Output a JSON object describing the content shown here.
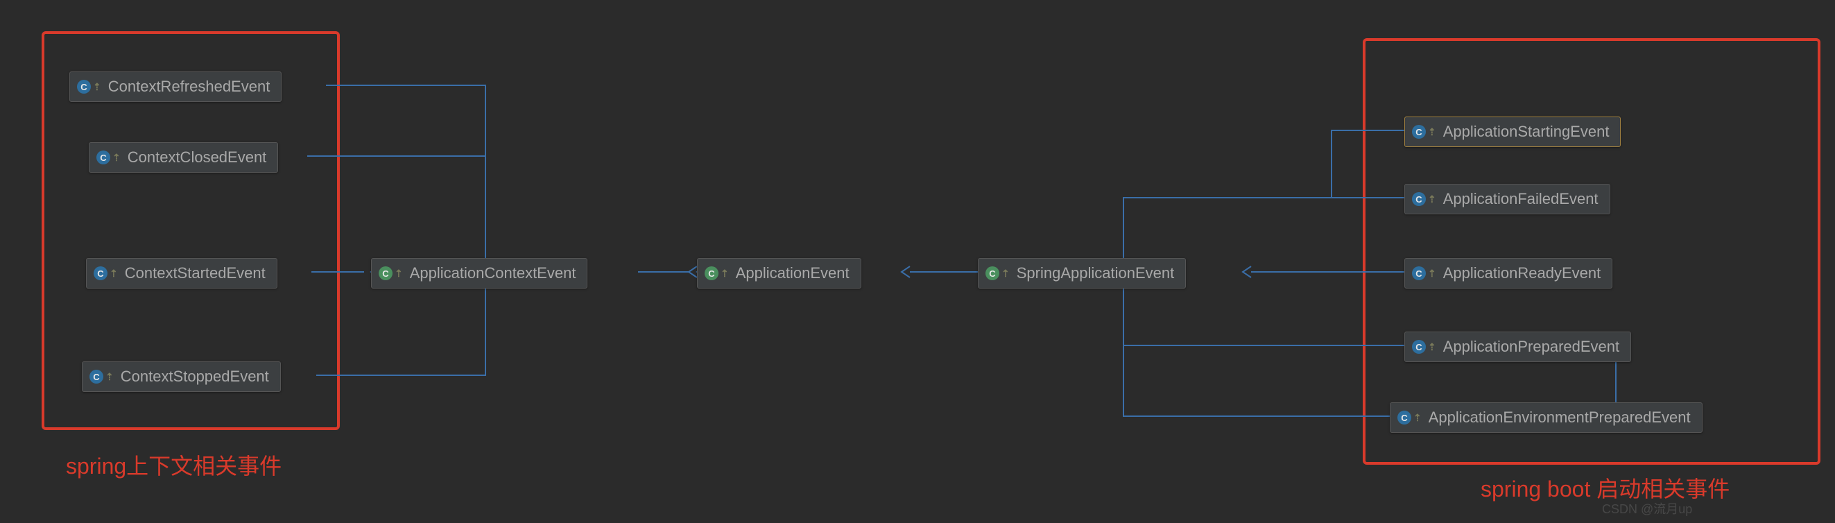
{
  "nodes": {
    "context_refreshed": {
      "label": "ContextRefreshedEvent",
      "type": "class"
    },
    "context_closed": {
      "label": "ContextClosedEvent",
      "type": "class"
    },
    "context_started": {
      "label": "ContextStartedEvent",
      "type": "class"
    },
    "context_stopped": {
      "label": "ContextStoppedEvent",
      "type": "class"
    },
    "app_context_event": {
      "label": "ApplicationContextEvent",
      "type": "abstract"
    },
    "app_event": {
      "label": "ApplicationEvent",
      "type": "abstract"
    },
    "spring_app_event": {
      "label": "SpringApplicationEvent",
      "type": "abstract"
    },
    "app_starting": {
      "label": "ApplicationStartingEvent",
      "type": "class"
    },
    "app_failed": {
      "label": "ApplicationFailedEvent",
      "type": "class"
    },
    "app_ready": {
      "label": "ApplicationReadyEvent",
      "type": "class"
    },
    "app_prepared": {
      "label": "ApplicationPreparedEvent",
      "type": "class"
    },
    "app_env_prepared": {
      "label": "ApplicationEnvironmentPreparedEvent",
      "type": "class"
    }
  },
  "groups": {
    "left": {
      "label": "spring上下文相关事件"
    },
    "right": {
      "label": "spring boot 启动相关事件"
    }
  },
  "watermark": "CSDN @流月up",
  "chart_data": {
    "type": "diagram",
    "nodes": [
      "ContextRefreshedEvent",
      "ContextClosedEvent",
      "ContextStartedEvent",
      "ContextStoppedEvent",
      "ApplicationContextEvent",
      "ApplicationEvent",
      "SpringApplicationEvent",
      "ApplicationStartingEvent",
      "ApplicationFailedEvent",
      "ApplicationReadyEvent",
      "ApplicationPreparedEvent",
      "ApplicationEnvironmentPreparedEvent"
    ],
    "edges": [
      [
        "ContextRefreshedEvent",
        "ApplicationContextEvent"
      ],
      [
        "ContextClosedEvent",
        "ApplicationContextEvent"
      ],
      [
        "ContextStartedEvent",
        "ApplicationContextEvent"
      ],
      [
        "ContextStoppedEvent",
        "ApplicationContextEvent"
      ],
      [
        "ApplicationContextEvent",
        "ApplicationEvent"
      ],
      [
        "SpringApplicationEvent",
        "ApplicationEvent"
      ],
      [
        "ApplicationStartingEvent",
        "SpringApplicationEvent"
      ],
      [
        "ApplicationFailedEvent",
        "SpringApplicationEvent"
      ],
      [
        "ApplicationReadyEvent",
        "SpringApplicationEvent"
      ],
      [
        "ApplicationPreparedEvent",
        "SpringApplicationEvent"
      ],
      [
        "ApplicationEnvironmentPreparedEvent",
        "SpringApplicationEvent"
      ]
    ],
    "groups": [
      {
        "label": "spring上下文相关事件",
        "members": [
          "ContextRefreshedEvent",
          "ContextClosedEvent",
          "ContextStartedEvent",
          "ContextStoppedEvent"
        ]
      },
      {
        "label": "spring boot 启动相关事件",
        "members": [
          "ApplicationStartingEvent",
          "ApplicationFailedEvent",
          "ApplicationReadyEvent",
          "ApplicationPreparedEvent",
          "ApplicationEnvironmentPreparedEvent"
        ]
      }
    ]
  }
}
